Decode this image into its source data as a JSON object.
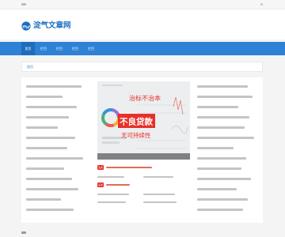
{
  "site": {
    "name": "淀气文章网",
    "brand_color": "#1d6fc0",
    "nav_color": "#2d81d6",
    "accent_red": "#e8302a"
  },
  "nav": {
    "items": [
      "首页",
      "栏目",
      "栏目",
      "栏目",
      "栏目"
    ]
  },
  "breadcrumb": "首页",
  "feature": {
    "line1": "治标不治本",
    "line2": "不良贷款",
    "line3": "无可持续性"
  },
  "badges": {
    "hot": "头条"
  }
}
